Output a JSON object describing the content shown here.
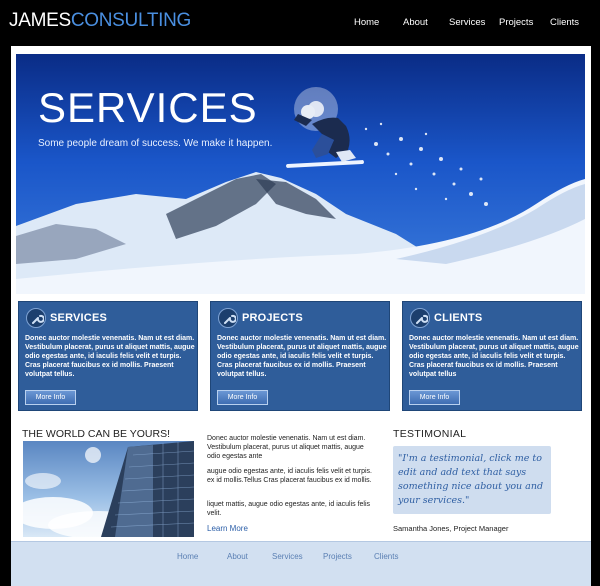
{
  "header": {
    "logo_part1": "JAMES",
    "logo_part2": "CONSULTING",
    "nav": [
      "Home",
      "About",
      "Services",
      "Projects",
      "Clients"
    ]
  },
  "hero": {
    "title": "SERVICES",
    "subtitle": "Some people dream of success. We make it happen."
  },
  "boxes": [
    {
      "icon": "wrench-icon",
      "title": "SERVICES",
      "text": "Donec auctor molestie venenatis. Nam ut est diam. Vestibulum placerat, purus ut aliquet mattis, augue odio egestas ante, id iaculis felis velit et turpis. Cras placerat faucibus ex id mollis. Praesent volutpat tellus.",
      "button": "More Info"
    },
    {
      "icon": "wrench-icon",
      "title": "PROJECTS",
      "text": "Donec auctor molestie venenatis. Nam ut est diam. Vestibulum placerat, purus ut aliquet mattis, augue odio egestas ante, id iaculis felis velit et turpis. Cras placerat faucibus ex id mollis. Praesent volutpat tellus.",
      "button": "More Info"
    },
    {
      "icon": "wrench-icon",
      "title": "CLIENTS",
      "text": "Donec auctor molestie venenatis. Nam ut est diam. Vestibulum placerat, purus ut aliquet mattis, augue odio egestas ante, id iaculis felis velit et turpis. Cras placerat faucibus ex id mollis. Praesent volutpat tellus",
      "button": "More Info"
    }
  ],
  "world": {
    "title": "THE WORLD CAN BE YOURS!",
    "para1": "Donec auctor molestie venenatis. Nam ut est diam. Vestibulum placerat, purus ut aliquet mattis, augue odio egestas ante",
    "para2": "augue odio egestas ante, id iaculis felis velit et turpis. ex id mollis.Tellus Cras placerat faucibus ex id mollis.",
    "para3": "liquet mattis, augue odio egestas ante, id iaculis felis velit.",
    "learn_more": "Learn More"
  },
  "testimonial": {
    "title": "TESTIMONIAL",
    "quote": "\"I'm a testimonial, click me to edit and add text that says something nice about you and your services.\"",
    "author": "Samantha Jones, Project Manager"
  },
  "footer": {
    "nav": [
      "Home",
      "About",
      "Services",
      "Projects",
      "Clients"
    ]
  },
  "colors": {
    "accent": "#4a8fe0",
    "box_bg": "#2f5d9a",
    "footer_bg": "#d2e0f1",
    "testimonial_bg": "#cfddef"
  }
}
